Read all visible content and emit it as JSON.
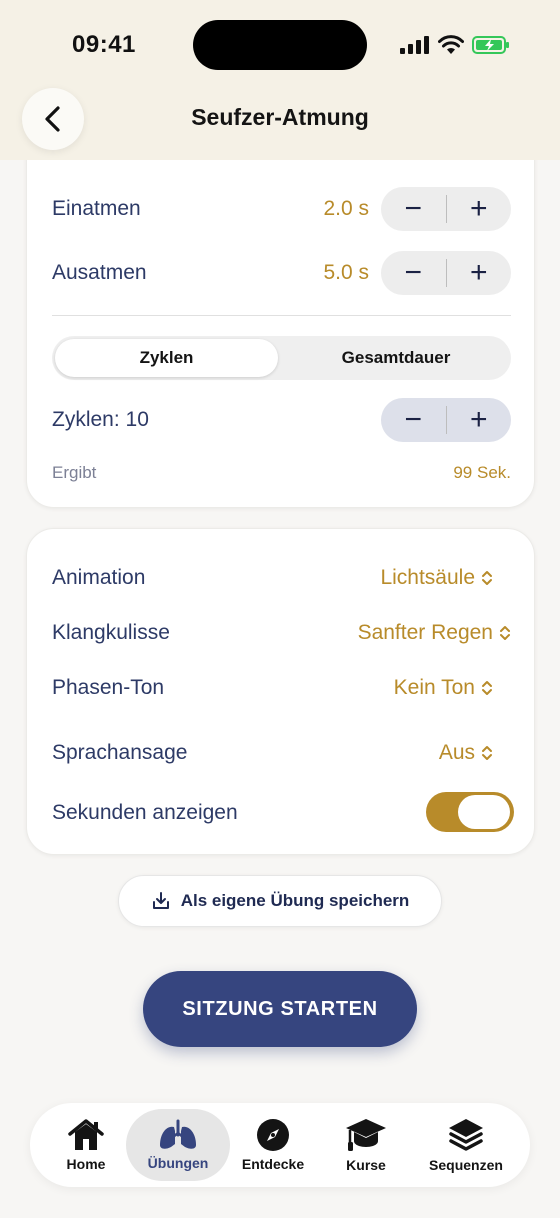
{
  "status": {
    "time": "09:41"
  },
  "header": {
    "title": "Seufzer-Atmung"
  },
  "breathing": {
    "inhale": {
      "label": "Einatmen",
      "value": "2.0 s"
    },
    "exhale": {
      "label": "Ausatmen",
      "value": "5.0 s"
    },
    "stepper": {
      "minus": "−",
      "plus": "+"
    }
  },
  "mode": {
    "options": [
      "Zyklen",
      "Gesamtdauer"
    ],
    "selected": "Zyklen"
  },
  "cycles": {
    "label": "Zyklen: 10",
    "result_label": "Ergibt",
    "result_value": "99 Sek."
  },
  "settings": {
    "animation": {
      "label": "Animation",
      "value": "Lichtsäule"
    },
    "soundscape": {
      "label": "Klangkulisse",
      "value": "Sanfter Regen"
    },
    "phase_tone": {
      "label": "Phasen-Ton",
      "value": "Kein Ton"
    },
    "voice": {
      "label": "Sprachansage",
      "value": "Aus"
    },
    "show_seconds": {
      "label": "Sekunden anzeigen",
      "enabled": true
    }
  },
  "actions": {
    "save": "Als eigene Übung speichern",
    "start": "SITZUNG STARTEN"
  },
  "tabs": [
    {
      "label": "Home",
      "icon": "house-icon"
    },
    {
      "label": "Übungen",
      "icon": "lungs-icon",
      "selected": true
    },
    {
      "label": "Entdecke",
      "icon": "compass-icon"
    },
    {
      "label": "Kurse",
      "icon": "graduation-cap-icon"
    },
    {
      "label": "Sequenzen",
      "icon": "layers-icon"
    }
  ],
  "colors": {
    "accent": "#b88b2a",
    "primary": "#36457f",
    "text": "#2d3a66"
  }
}
